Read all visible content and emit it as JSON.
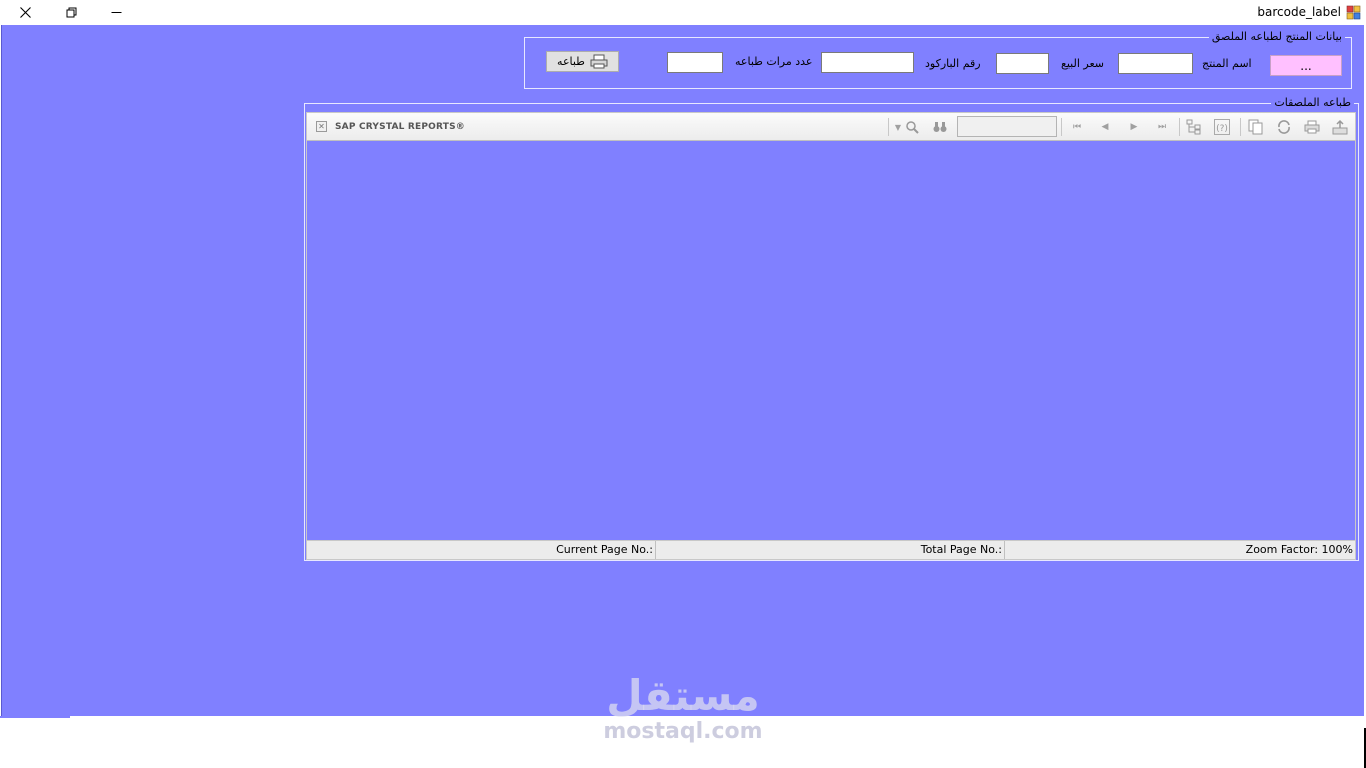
{
  "window": {
    "title": "barcode_label"
  },
  "product_group": {
    "legend": "بيانات المنتج لطباعه الملصق",
    "browse_button": "...",
    "product_name_label": "اسم المنتج",
    "product_name_value": "",
    "sale_price_label": "سعر البيع",
    "sale_price_value": "",
    "barcode_label": "رقم الباركود",
    "barcode_value": "",
    "print_count_label": "عدد مرات طباعه",
    "print_count_value": "",
    "print_button": "طباعه"
  },
  "labels_group": {
    "legend": "طباعه الملصقات"
  },
  "viewer": {
    "brand": "SAP CRYSTAL REPORTS®",
    "status": {
      "current_page": "Current Page No.:",
      "total_page": "Total Page No.:",
      "zoom": "Zoom Factor: 100%"
    }
  },
  "watermark": {
    "arabic": "مستقل",
    "latin": "mostaql.com"
  },
  "colors": {
    "background": "#8080ff",
    "browse_button": "#ffc0ff"
  },
  "icons": {
    "app": "app-grid-icon",
    "close": "close-icon",
    "restore": "restore-icon",
    "minimize": "minimize-icon",
    "printer": "printer-icon"
  }
}
